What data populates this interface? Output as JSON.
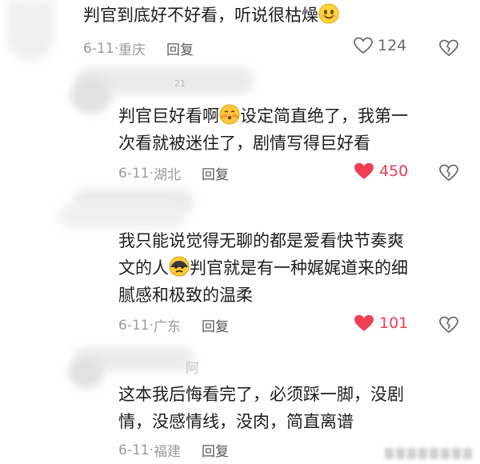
{
  "comments": [
    {
      "text": "判官到底好不好看，听说很枯燥",
      "date": "6-11",
      "location": "重庆",
      "reply_label": "回复",
      "likes": "124",
      "liked": false
    },
    {
      "line1a": "判官巨好看啊",
      "line1b": "设定简直绝了，我第一",
      "line2": "次看就被迷住了，剧情写得巨好看",
      "date": "6-11",
      "location": "湖北",
      "reply_label": "回复",
      "likes": "450",
      "liked": true
    },
    {
      "line1": "我只能说觉得无聊的都是爱看快节奏爽",
      "line2a": "文的人",
      "line2b": "判官就是有一种娓娓道来的细",
      "line3": "腻感和极致的温柔",
      "date": "6-11",
      "location": "广东",
      "reply_label": "回复",
      "likes": "101",
      "liked": true
    },
    {
      "line1": "这本我后悔看完了，必须踩一脚，没剧",
      "line2": "情，没感情线，没肉，简直离谱",
      "date": "6-11",
      "location": "福建",
      "reply_label": "回复"
    }
  ],
  "partial_username": "阿",
  "partial_badge": "21",
  "separator": "·",
  "colors": {
    "liked": "#f03d54",
    "meta": "#9a9a9a"
  },
  "icons": [
    "heart-icon",
    "heart-filled-icon",
    "broken-heart-icon",
    "smile-emoji",
    "blushing-emoji",
    "sweating-emoji"
  ]
}
